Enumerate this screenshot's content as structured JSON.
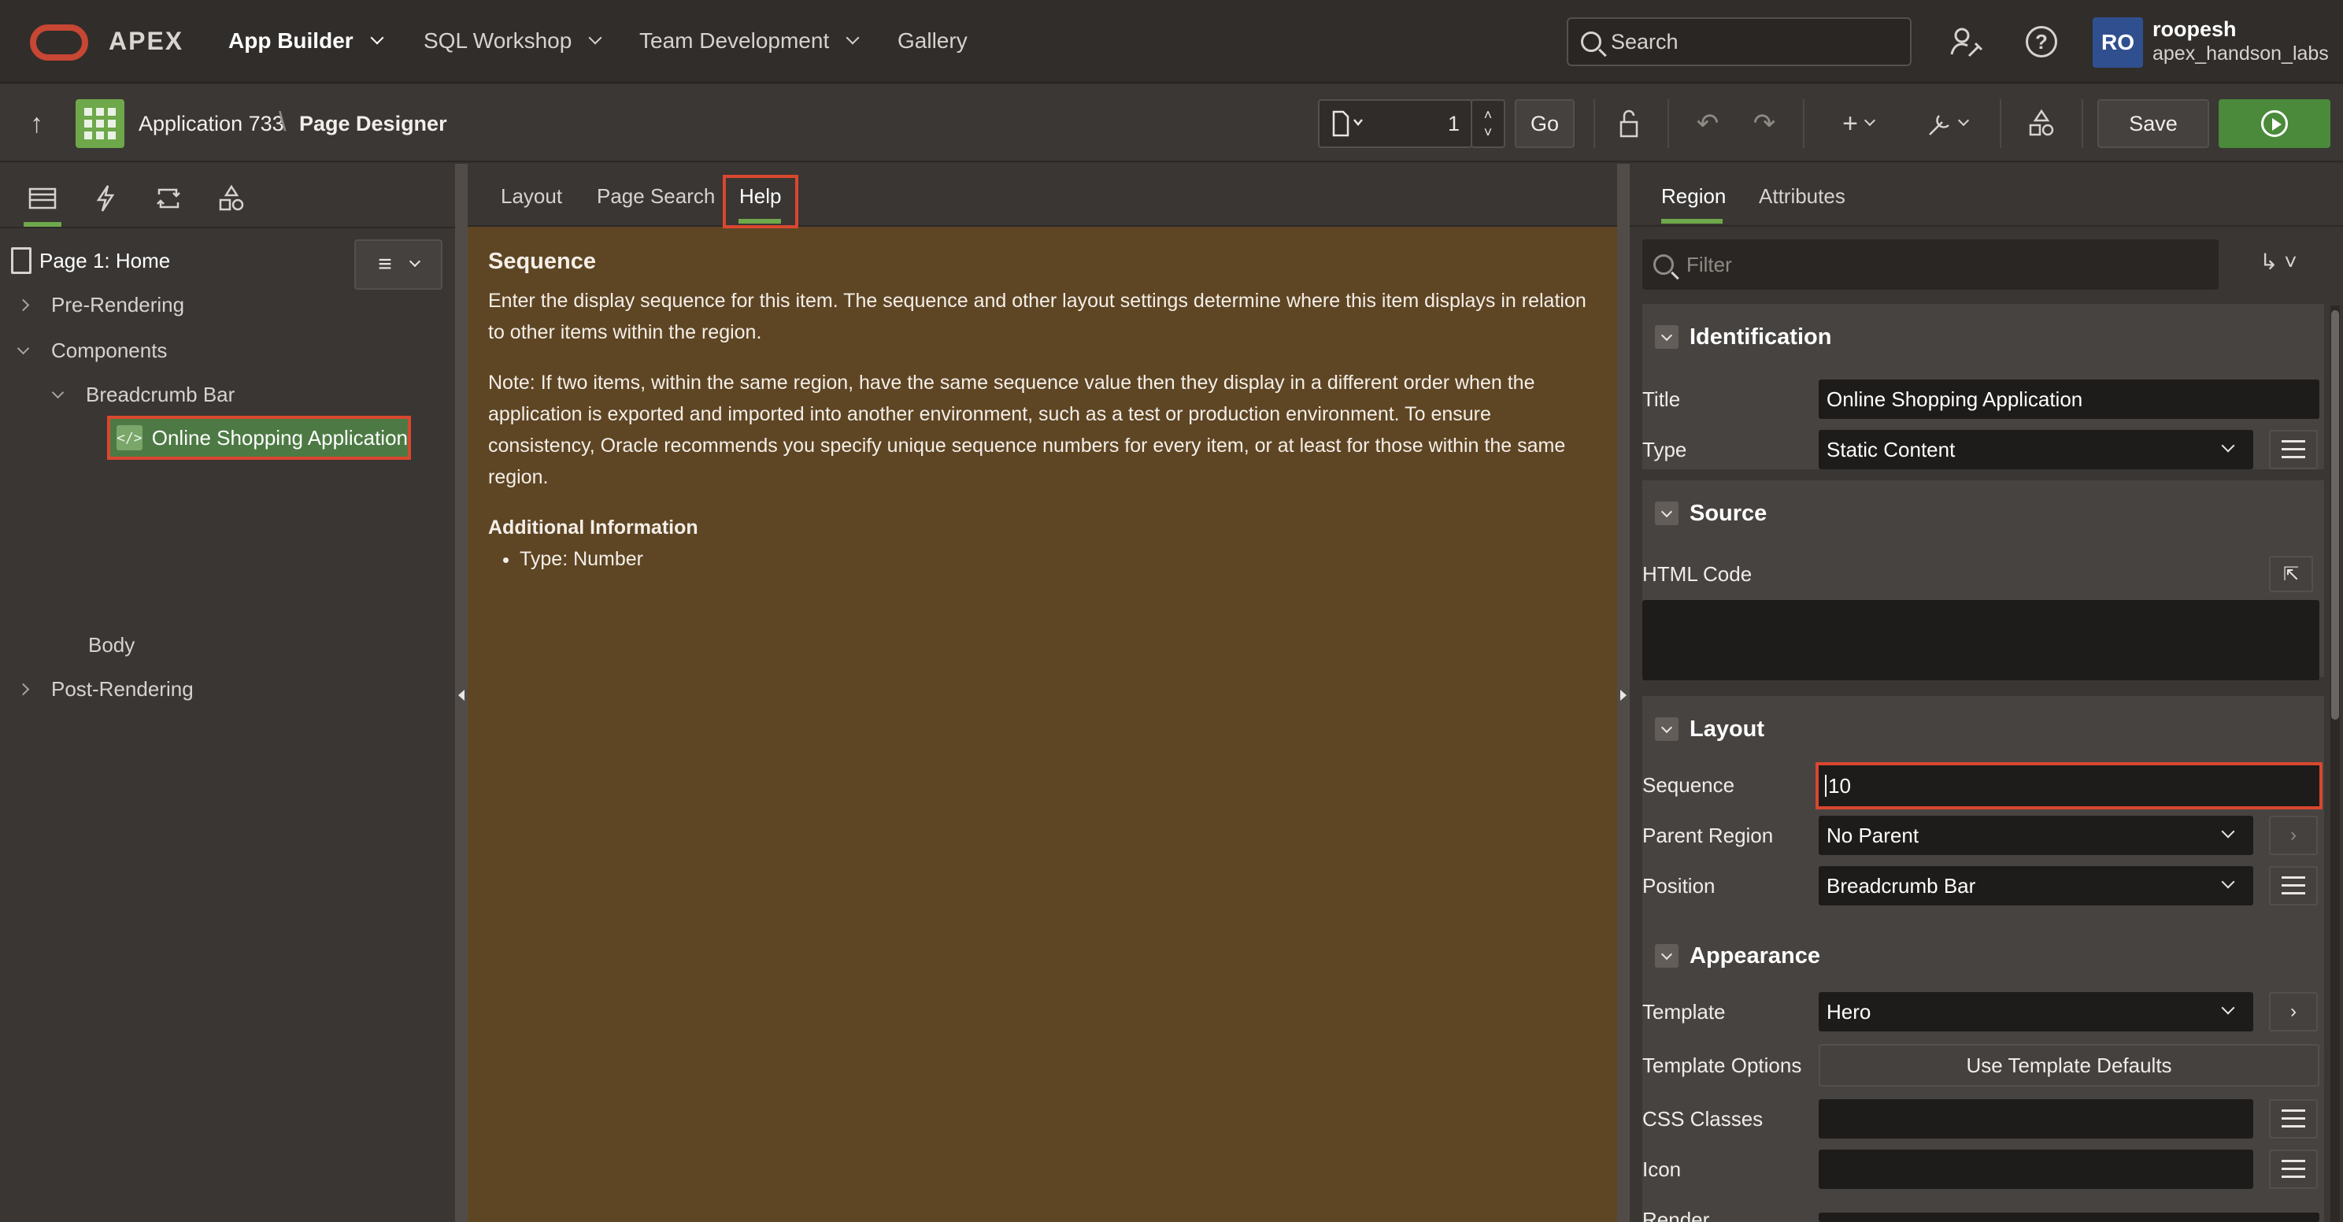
{
  "app": {
    "brand": "APEX",
    "accent": "#6ea84a",
    "highlight": "#d9472f",
    "help_bg": "#5e4524"
  },
  "topnav": {
    "items": [
      {
        "label": "App Builder",
        "dropdown": true
      },
      {
        "label": "SQL Workshop",
        "dropdown": true
      },
      {
        "label": "Team Development",
        "dropdown": true
      },
      {
        "label": "Gallery",
        "dropdown": false
      }
    ],
    "search_placeholder": "Search",
    "user": {
      "initials": "RO",
      "name": "roopesh",
      "workspace": "apex_handson_labs"
    }
  },
  "toolbar": {
    "breadcrumb": [
      "Application 733",
      "Page Designer"
    ],
    "page_number": "1",
    "go_label": "Go",
    "save_label": "Save",
    "icons": [
      "up-arrow",
      "page-selector",
      "lock",
      "undo",
      "redo",
      "create",
      "utilities",
      "shared-components",
      "run"
    ]
  },
  "left_pane": {
    "tabs": [
      "rendering",
      "dynamic-actions",
      "processing",
      "shared-components"
    ],
    "tree": {
      "page": "Page 1: Home",
      "pre_rendering": "Pre-Rendering",
      "components": "Components",
      "breadcrumb_bar": "Breadcrumb Bar",
      "selected_region": "Online Shopping Application",
      "body": "Body",
      "post_rendering": "Post-Rendering"
    }
  },
  "center_pane": {
    "tabs": [
      "Layout",
      "Page Search",
      "Help"
    ],
    "active_tab": "Help",
    "help": {
      "title": "Sequence",
      "para1": "Enter the display sequence for this item. The sequence and other layout settings determine where this item displays in relation to other items within the region.",
      "para2": "Note: If two items, within the same region, have the same sequence value then they display in a different order when the application is exported and imported into another environment, such as a test or production environment. To ensure consistency, Oracle recommends you specify unique sequence numbers for every item, or at least for those within the same region.",
      "additional_title": "Additional Information",
      "type_item": "Type: Number"
    }
  },
  "right_pane": {
    "tabs": [
      "Region",
      "Attributes"
    ],
    "active_tab": "Region",
    "filter_placeholder": "Filter",
    "identification": {
      "header": "Identification",
      "title_label": "Title",
      "title_value": "Online Shopping Application",
      "type_label": "Type",
      "type_value": "Static Content"
    },
    "source": {
      "header": "Source",
      "html_code_label": "HTML Code",
      "html_code_value": ""
    },
    "layout": {
      "header": "Layout",
      "sequence_label": "Sequence",
      "sequence_value": "10",
      "parent_label": "Parent Region",
      "parent_value": "No Parent",
      "position_label": "Position",
      "position_value": "Breadcrumb Bar"
    },
    "appearance": {
      "header": "Appearance",
      "template_label": "Template",
      "template_value": "Hero",
      "template_options_label": "Template Options",
      "template_options_button": "Use Template Defaults",
      "css_label": "CSS Classes",
      "css_value": "",
      "icon_label": "Icon",
      "icon_value": "",
      "render_label": "Render"
    }
  }
}
